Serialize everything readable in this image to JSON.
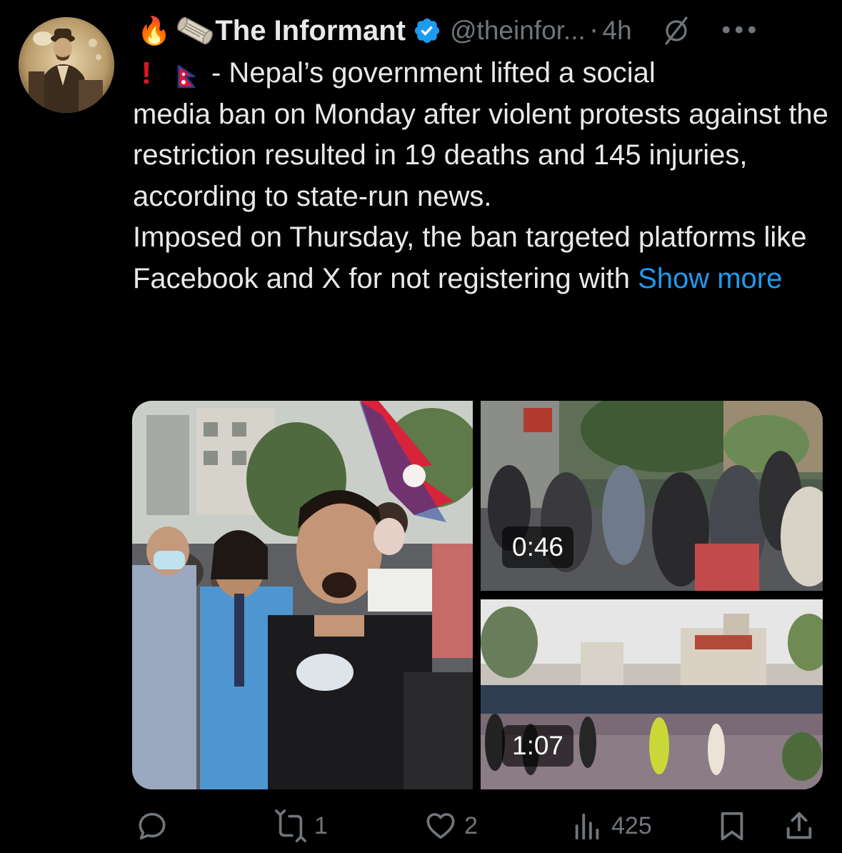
{
  "author": {
    "name": "The Informant",
    "handle": "@theinfor...",
    "separator": "·",
    "time": "4h",
    "leading_emojis": [
      "🔥",
      "scroll-emoji"
    ],
    "verified": true
  },
  "post": {
    "prefix_icons": [
      "exclamation-icon",
      "nepal-flag-icon"
    ],
    "line1": "- Nepal’s government lifted a social",
    "paragraph1_rest": "media ban on Monday after violent protests against the restriction resulted in 19 deaths and 145 injuries, according to state-run news.",
    "paragraph2": "Imposed on Thursday, the ban targeted platforms like Facebook and X for not registering with",
    "show_more": "Show more"
  },
  "media": {
    "videos": [
      {
        "duration": "0:46"
      },
      {
        "duration": "1:07"
      }
    ]
  },
  "actions": {
    "reply_count": "",
    "repost_count": "1",
    "like_count": "2",
    "views_count": "425"
  },
  "colors": {
    "background": "#000000",
    "text": "#e7e9ea",
    "muted": "#71767b",
    "link": "#1d9bf0",
    "verified": "#1d9bf0"
  }
}
